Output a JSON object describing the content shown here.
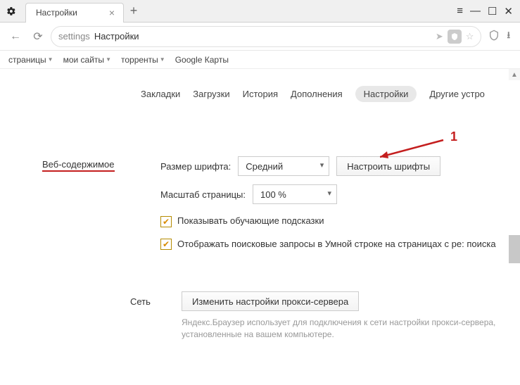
{
  "titlebar": {
    "tab_title": "Настройки",
    "close_glyph": "×",
    "plus_glyph": "+"
  },
  "window_controls": {
    "menu": "≡",
    "min": "—",
    "max": "☐",
    "close": "✕"
  },
  "addressbar": {
    "path_grey": "settings",
    "path_main": "Настройки"
  },
  "bookmarks": {
    "items": [
      {
        "label": "страницы"
      },
      {
        "label": "мои сайты"
      },
      {
        "label": "торренты"
      },
      {
        "label": "Google Карты"
      }
    ]
  },
  "inner_nav": {
    "items": [
      {
        "label": "Закладки"
      },
      {
        "label": "Загрузки"
      },
      {
        "label": "История"
      },
      {
        "label": "Дополнения"
      },
      {
        "label": "Настройки"
      },
      {
        "label": "Другие устро"
      }
    ],
    "active_index": 4
  },
  "section": {
    "web_content": "Веб-содержимое",
    "font_size_label": "Размер шрифта:",
    "font_size_value": "Средний",
    "configure_fonts": "Настроить шрифты",
    "page_scale_label": "Масштаб страницы:",
    "page_scale_value": "100 %",
    "chk_hints": "Показывать обучающие подсказки",
    "chk_smartbar": "Отображать поисковые запросы в Умной строке на страницах с ре: поиска",
    "network_label": "Сеть",
    "proxy_button": "Изменить настройки прокси-сервера",
    "proxy_desc": "Яндекс.Браузер использует для подключения к сети настройки прокси-сервера, установленные на вашем компьютере."
  },
  "annotation": {
    "marker": "1"
  }
}
